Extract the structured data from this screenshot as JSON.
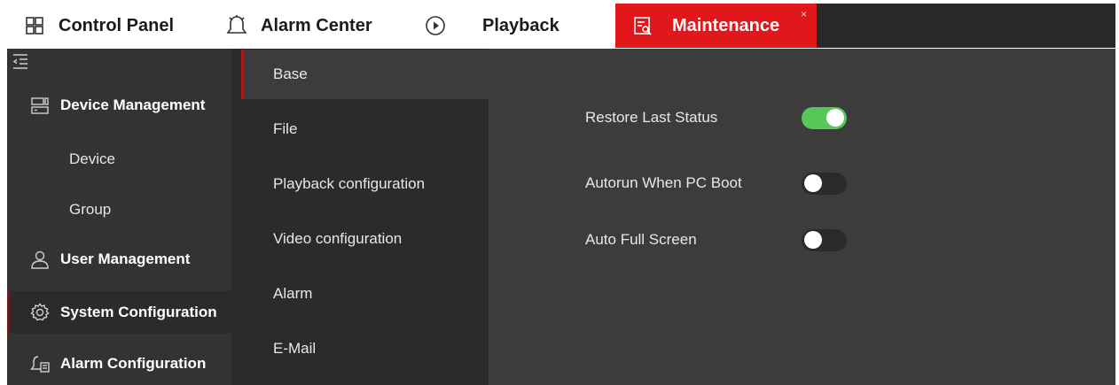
{
  "tabs": [
    {
      "label": "Control Panel",
      "icon": "grid-icon"
    },
    {
      "label": "Alarm Center",
      "icon": "bell-icon"
    },
    {
      "label": "Playback",
      "icon": "play-circle-icon"
    },
    {
      "label": "Maintenance",
      "icon": "maintenance-icon",
      "active": true,
      "close": "×"
    }
  ],
  "sidebar": {
    "collapse_icon": "collapse-menu-icon",
    "items": [
      {
        "label": "Device Management",
        "icon": "device-management-icon",
        "type": "group"
      },
      {
        "label": "Device",
        "type": "sub"
      },
      {
        "label": "Group",
        "type": "sub"
      },
      {
        "label": "User Management",
        "icon": "user-icon",
        "type": "group"
      },
      {
        "label": "System Configuration",
        "icon": "gear-icon",
        "type": "group",
        "selected": true
      },
      {
        "label": "Alarm Configuration",
        "icon": "alarm-config-icon",
        "type": "group"
      }
    ]
  },
  "submenu": {
    "items": [
      {
        "label": "Base",
        "active": true
      },
      {
        "label": "File"
      },
      {
        "label": "Playback configuration"
      },
      {
        "label": "Video configuration"
      },
      {
        "label": "Alarm"
      },
      {
        "label": "E-Mail"
      }
    ]
  },
  "settings": [
    {
      "label": "Restore Last Status",
      "enabled": true
    },
    {
      "label": "Autorun When PC Boot",
      "enabled": false
    },
    {
      "label": "Auto Full Screen",
      "enabled": false
    }
  ],
  "colors": {
    "accent_red": "#e0171b",
    "toggle_on": "#55c857",
    "sidebar_bg": "#333333",
    "content_bg": "#3c3c3c"
  }
}
